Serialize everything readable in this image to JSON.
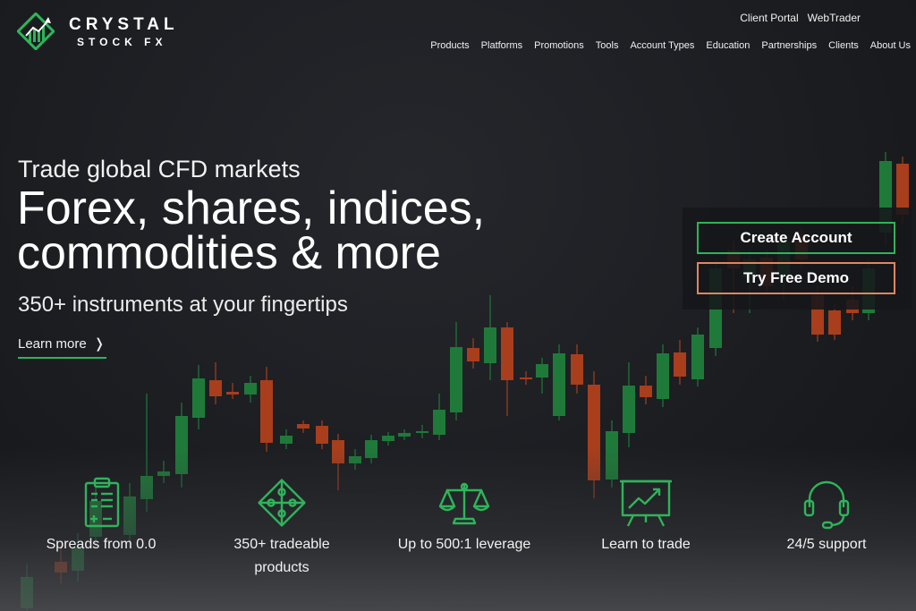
{
  "brand": {
    "name_line1": "CRYSTAL",
    "name_line2": "STOCK FX",
    "accent": "#2fb45a",
    "accent_orange": "#e08660"
  },
  "utility_nav": [
    "Client Portal",
    "WebTrader"
  ],
  "main_nav": [
    "Products",
    "Platforms",
    "Promotions",
    "Tools",
    "Account Types",
    "Education",
    "Partnerships",
    "Clients",
    "About Us"
  ],
  "hero": {
    "eyebrow": "Trade global CFD markets",
    "title_line1": "Forex, shares, indices,",
    "title_line2": "commodities & more",
    "subtitle": "350+ instruments at your fingertips",
    "learn_more": "Learn more",
    "learn_more_icon": "chevron-right-icon"
  },
  "cta": {
    "create_account": "Create Account",
    "try_demo": "Try Free Demo"
  },
  "features": [
    {
      "icon": "clipboard-icon",
      "line1": "Spreads from 0.0",
      "line2": ""
    },
    {
      "icon": "puzzle-icon",
      "line1": "350+ tradeable",
      "line2": "products"
    },
    {
      "icon": "scales-icon",
      "line1": "Up to 500:1 leverage",
      "line2": ""
    },
    {
      "icon": "presentation-chart-icon",
      "line1": "Learn to trade",
      "line2": ""
    },
    {
      "icon": "headset-icon",
      "line1": "24/5 support",
      "line2": ""
    }
  ],
  "background_chart": {
    "type": "candlestick",
    "colors": {
      "up": "#1f7a3a",
      "down": "#a83e1c"
    }
  }
}
